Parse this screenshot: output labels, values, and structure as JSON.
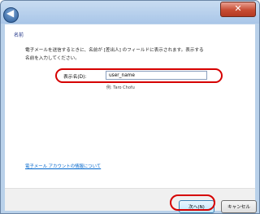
{
  "window": {
    "close_label": "✕"
  },
  "nav": {
    "back_icon": "back-arrow-icon"
  },
  "page": {
    "heading": "名前",
    "intro_line1": "電子メールを送信するときに、名前が [差出人] のフィールドに表示されます。表示する",
    "intro_line2": "名前を入力してください。",
    "field_label": "表示名(D):",
    "field_value": "user_name",
    "example": "例: Taro Chofu",
    "link": "電子メール アカウントの情報について"
  },
  "footer": {
    "next_label": "次へ(N)",
    "cancel_label": "キャンセル"
  },
  "colors": {
    "highlight": "#d60000",
    "link": "#0066cc",
    "heading": "#1e3287"
  }
}
